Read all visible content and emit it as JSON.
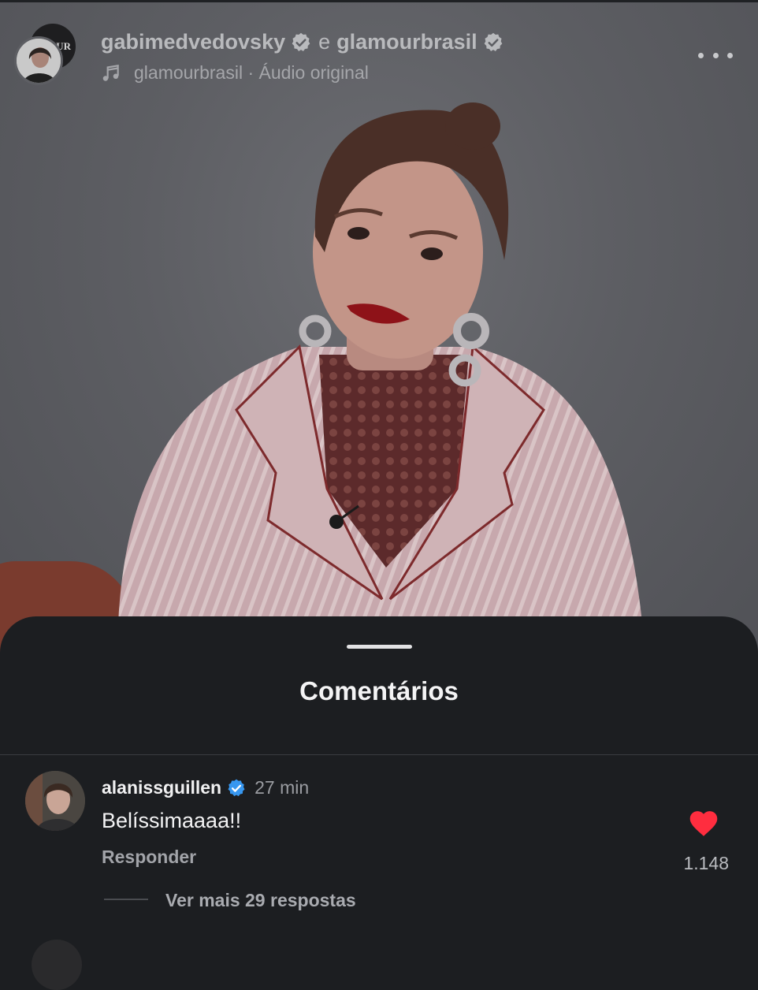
{
  "post": {
    "creator": "gabimedvedovsky",
    "conjunction": "e",
    "collaborator": "glamourbrasil",
    "avatar_back_text": "OUR",
    "audio_label": "glamourbrasil · Áudio original"
  },
  "comments_sheet": {
    "title": "Comentários"
  },
  "comment": {
    "username": "alanissguillen",
    "time": "27 min",
    "text": "Belíssimaaaa!!",
    "reply_label": "Responder",
    "like_count": "1.148",
    "view_replies_label": "Ver mais 29 respostas"
  },
  "colors": {
    "sheet_background": "#1c1e21",
    "verified_blue": "#3797f0",
    "heart_red": "#ff2d3f",
    "video_overlay_grey": "#5d5e63"
  },
  "icons": [
    "verified-badge-icon",
    "music-note-icon",
    "more-options-icon",
    "heart-icon"
  ]
}
